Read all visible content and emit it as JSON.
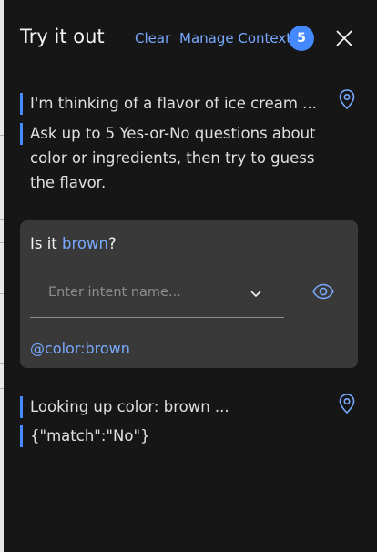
{
  "header": {
    "title": "Try it out",
    "clear_label": "Clear",
    "manage_context_label": "Manage Context",
    "context_count": "5"
  },
  "messages": {
    "first": {
      "line1": "I'm thinking of a flavor of ice cream ...",
      "line2": "Ask up to 5 Yes-or-No questions about color or ingredients, then try to guess the flavor."
    },
    "card": {
      "question_prefix": "Is it ",
      "question_highlight": "brown",
      "question_suffix": "?",
      "intent_placeholder": "Enter intent name...",
      "entity": "@color:brown"
    },
    "second": {
      "line1": "Looking up color: brown ...",
      "line2": "{\"match\":\"No\"}"
    }
  },
  "colors": {
    "accent": "#4589ff",
    "link": "#78a9ff",
    "panel": "#161616",
    "card": "#393939"
  },
  "icons": {
    "close": "close-icon",
    "location": "location-icon",
    "chevron": "chevron-down-icon",
    "eye": "eye-icon"
  }
}
